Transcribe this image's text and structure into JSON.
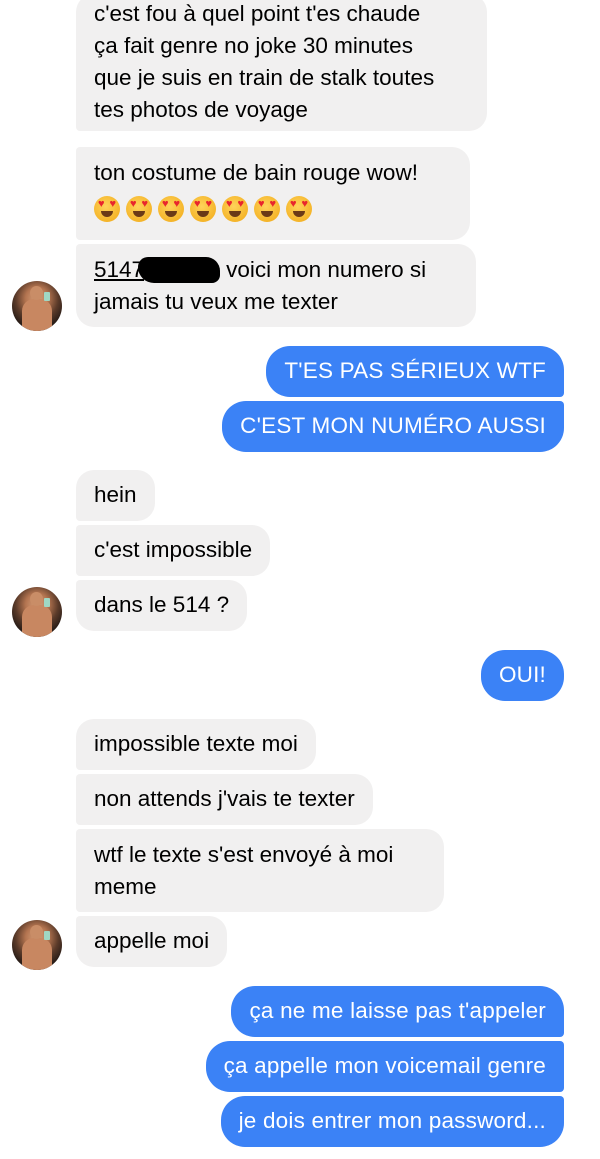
{
  "conversation": {
    "m1": {
      "lines": [
        "c'est fou à quel point t'es chaude",
        "ça fait genre no joke 30 minutes",
        "que je suis en train de stalk toutes",
        "tes photos de voyage"
      ]
    },
    "m2": {
      "text": "ton costume de bain rouge wow!",
      "emoji_icon": "heart-eyes-emoji",
      "emoji_count": 7
    },
    "m3": {
      "phone_prefix": "5147",
      "line1_rest": "voici mon numero si",
      "line2": "jamais tu veux me texter"
    },
    "m4": {
      "text": "T'ES PAS SÉRIEUX WTF"
    },
    "m5": {
      "text": "C'EST MON NUMÉRO AUSSI"
    },
    "m6": {
      "text": "hein"
    },
    "m7": {
      "text": "c'est impossible"
    },
    "m8": {
      "text": "dans le 514 ?"
    },
    "m9": {
      "text": "OUI!"
    },
    "m10": {
      "text": "impossible texte moi"
    },
    "m11": {
      "text": "non attends j'vais te texter"
    },
    "m12": {
      "lines": [
        "wtf le texte s'est envoyé à moi",
        "meme"
      ]
    },
    "m13": {
      "text": "appelle moi"
    },
    "m14": {
      "text": "ça ne me laisse pas t'appeler"
    },
    "m15": {
      "text": "ça appelle mon voicemail genre"
    },
    "m16": {
      "text": "je dois entrer mon password..."
    }
  },
  "colors": {
    "incoming_bubble": "#f1f0f0",
    "outgoing_bubble": "#3b82f6",
    "outgoing_text": "#ffffff"
  }
}
